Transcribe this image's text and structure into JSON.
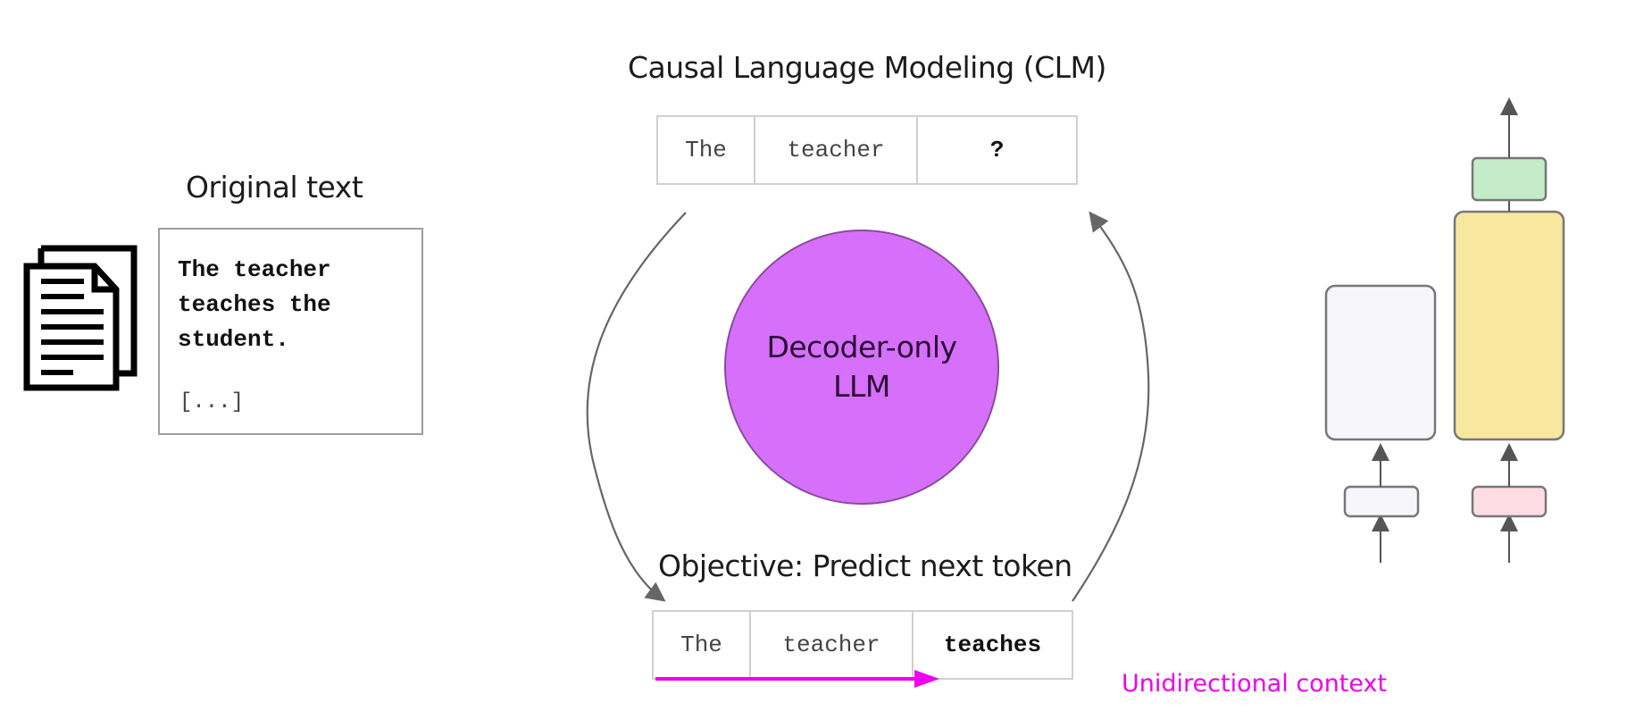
{
  "original": {
    "title": "Original text",
    "icon": "document-icon",
    "lines": [
      "The teacher",
      "teaches the",
      "student."
    ],
    "ellipsis": "[...]"
  },
  "clm": {
    "title": "Causal Language Modeling (CLM)",
    "input_tokens": [
      "The",
      "teacher",
      "?"
    ],
    "model_label_line1": "Decoder-only",
    "model_label_line2": "LLM",
    "objective": "Objective: Predict next token",
    "output_tokens": [
      "The",
      "teacher",
      "teaches"
    ],
    "context_label": "Unidirectional context"
  },
  "architecture": {
    "blocks": [
      {
        "name": "encoder-input-embedding",
        "color": "#f7f6fa"
      },
      {
        "name": "encoder-stack",
        "color": "#f7f6fa"
      },
      {
        "name": "decoder-input-embedding",
        "color": "#fddde3"
      },
      {
        "name": "decoder-stack",
        "color": "#f8e79e"
      },
      {
        "name": "decoder-output-layer",
        "color": "#c4ecc8"
      }
    ]
  },
  "colors": {
    "model_circle": "#d670fa",
    "context_arrow": "#ee00ee",
    "arrow": "#666666"
  }
}
